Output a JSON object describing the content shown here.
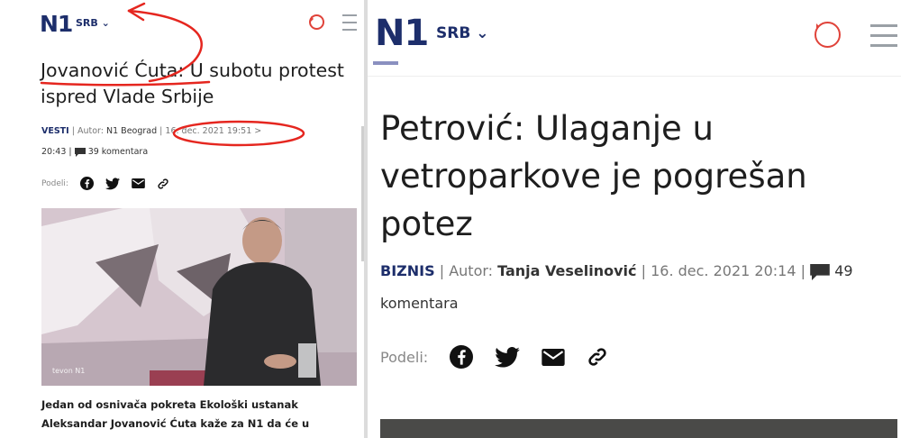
{
  "left": {
    "logo": "N1",
    "region": "SRB",
    "headline": "Jovanović Ćuta: U subotu protest ispred Vlade Srbije",
    "category": "VESTI",
    "author_label": "Autor:",
    "author": "N1 Beograd",
    "date": "16. dec. 2021 19:51 >",
    "date2": "20:43",
    "comments": "39 komentara",
    "share_label": "Podeli:",
    "photo_watermark": "tevon N1",
    "caption": "Jedan od osnivača pokreta Ekološki ustanak Aleksandar Jovanović Ćuta kaže za N1 da će u"
  },
  "right": {
    "logo": "N1",
    "region": "SRB",
    "headline": "Petrović: Ulaganje u vetroparkove je pogrešan potez",
    "category": "BIZNIS",
    "author_label": "Autor:",
    "author": "Tanja Veselinović",
    "date": "16. dec. 2021 20:14",
    "comments_count": "49",
    "comments_word": "komentara",
    "share_label": "Podeli:"
  },
  "colors": {
    "brand": "#1d2e6b",
    "accent": "#e0433a",
    "annotation": "#e5261f"
  }
}
